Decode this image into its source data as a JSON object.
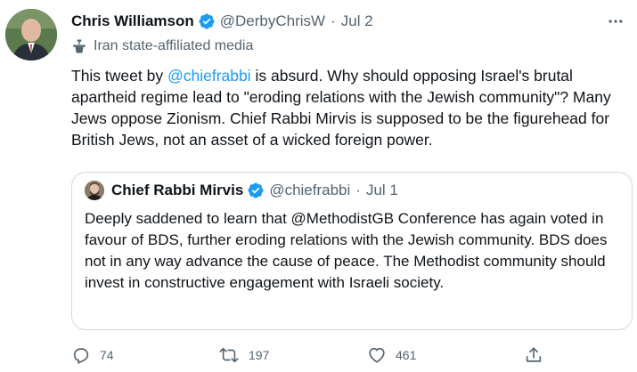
{
  "author": {
    "name": "Chris Williamson",
    "handle": "@DerbyChrisW",
    "separator": "·",
    "date": "Jul 2",
    "label": "Iran state-affiliated media"
  },
  "tweet": {
    "text_before": "This tweet by ",
    "mention": "@chiefrabbi",
    "text_after": " is absurd. Why should opposing Israel's brutal apartheid regime lead to \"eroding relations with the Jewish community\"? Many Jews oppose Zionism. Chief Rabbi Mirvis is supposed to be the figurehead for British Jews, not an asset of a wicked foreign power."
  },
  "quoted": {
    "name": "Chief Rabbi Mirvis",
    "handle": "@chiefrabbi",
    "separator": "·",
    "date": "Jul 1",
    "text": "Deeply saddened to learn that @MethodistGB Conference has again voted in favour of BDS, further eroding relations with the Jewish community. BDS does not in any way advance the cause of peace. The Methodist community should invest in constructive engagement with Israeli society."
  },
  "actions": {
    "replies": "74",
    "retweets": "197",
    "likes": "461"
  },
  "icons": {
    "verified": "verified-badge-icon",
    "more": "more-dots-icon",
    "label": "state-media-podium-icon",
    "reply": "reply-icon",
    "retweet": "retweet-icon",
    "like": "heart-icon",
    "share": "share-icon"
  },
  "colors": {
    "accent": "#1d9bf0",
    "text": "#0f1419",
    "secondary": "#536471",
    "border": "#cfd9de"
  }
}
